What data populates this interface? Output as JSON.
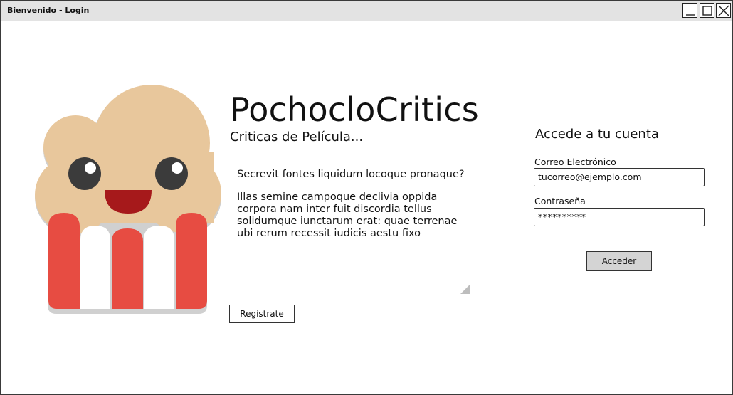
{
  "window": {
    "title": "Bienvenido - Login",
    "controls": {
      "minimize": "minimize-icon",
      "maximize": "maximize-icon",
      "close": "close-icon"
    }
  },
  "brand": {
    "name": "PochocloCritics",
    "tagline": "Criticas de Película...",
    "logo_icon": "popcorn-icon"
  },
  "description": {
    "paragraphs": [
      "Secrevit fontes liquidum locoque pronaque?",
      "Illas semine campoque declivia oppida corpora nam inter fuit discordia tellus solidumque iunctarum erat: quae terrenae ubi rerum recessit iudicis aestu fixo"
    ]
  },
  "register": {
    "label": "Regístrate"
  },
  "login": {
    "title": "Accede a tu cuenta",
    "email_label": "Correo Electrónico",
    "email_value": "tucorreo@ejemplo.com",
    "password_label": "Contraseña",
    "password_value": "**********",
    "submit_label": "Acceder"
  },
  "colors": {
    "titlebar": "#e3e3e3",
    "popcorn": "#e8c79c",
    "stripe_red": "#e74c42",
    "stripe_white": "#ffffff",
    "mouth": "#a6191b",
    "eyes": "#3b3b3b",
    "button_gray": "#d4d4d4"
  }
}
